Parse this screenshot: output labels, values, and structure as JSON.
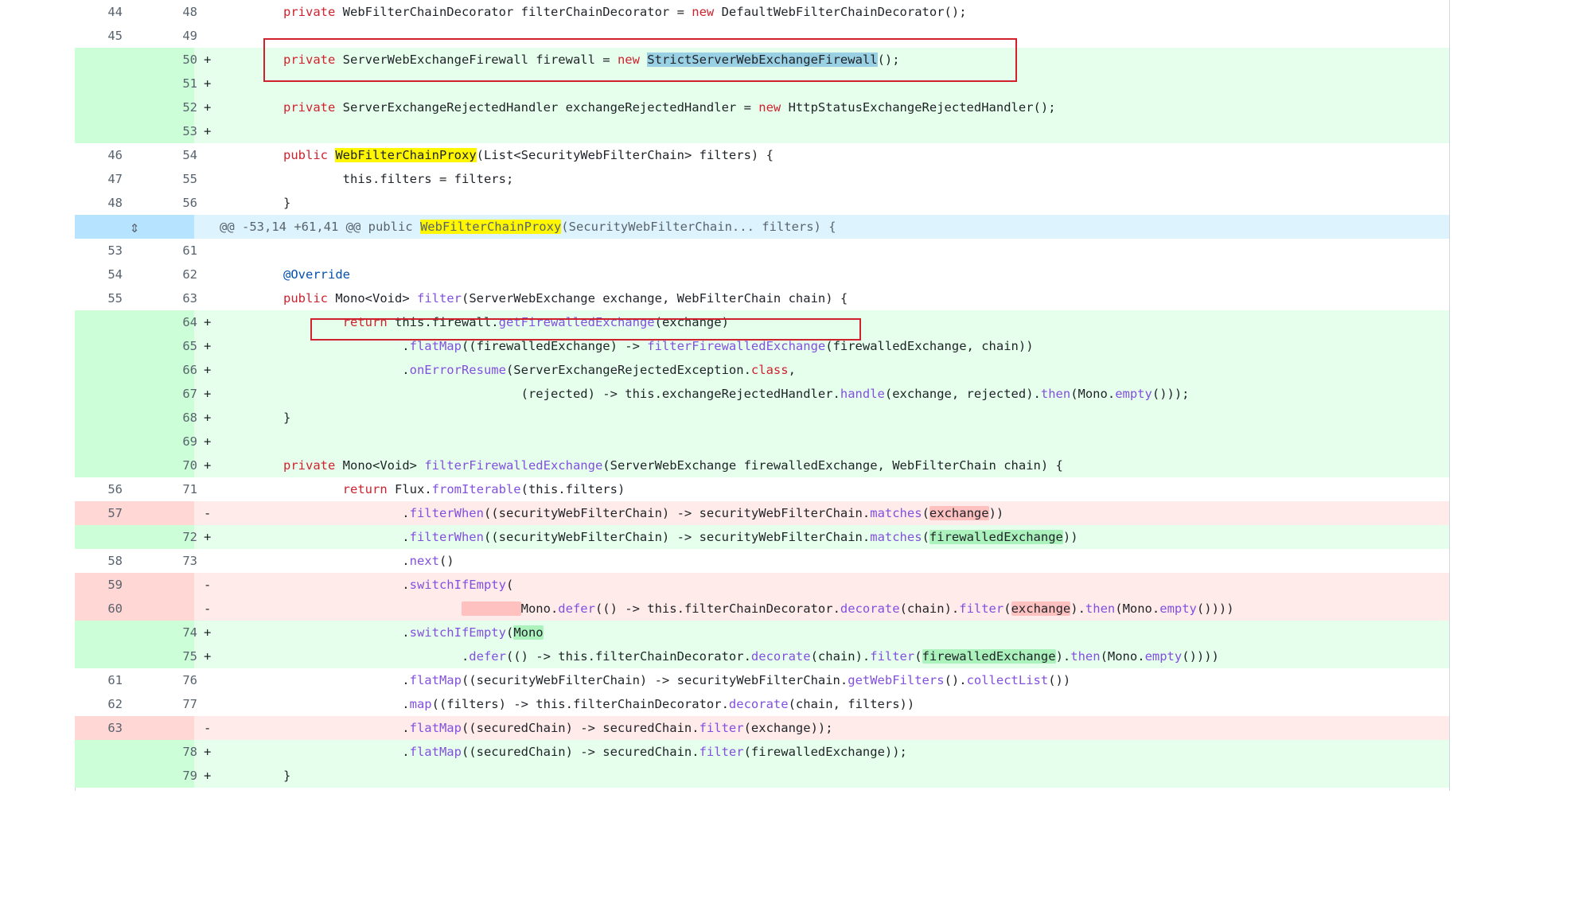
{
  "rows": [
    {
      "type": "ctx",
      "old": "44",
      "new": "48",
      "sign": "",
      "code": {
        "a": "private",
        "b": " WebFilterChainDecorator filterChainDecorator = ",
        "c": "new",
        "d": " DefaultWebFilterChainDecorator();"
      }
    },
    {
      "type": "ctx",
      "old": "45",
      "new": "49",
      "sign": "",
      "code": {
        "a": ""
      }
    },
    {
      "type": "add",
      "old": "",
      "new": "50",
      "sign": "+",
      "code": {
        "a": "private",
        "b": " ServerWebExchangeFirewall firewall = ",
        "c": "new",
        "d": " ",
        "e": "StrictServerWebExchangeFirewall",
        "f": "();"
      }
    },
    {
      "type": "add",
      "old": "",
      "new": "51",
      "sign": "+",
      "code": {
        "a": ""
      }
    },
    {
      "type": "add",
      "old": "",
      "new": "52",
      "sign": "+",
      "code": {
        "a": "private",
        "b": " ServerExchangeRejectedHandler exchangeRejectedHandler = ",
        "c": "new",
        "d": " HttpStatusExchangeRejectedHandler();"
      }
    },
    {
      "type": "add",
      "old": "",
      "new": "53",
      "sign": "+",
      "code": {
        "a": ""
      }
    },
    {
      "type": "ctx",
      "old": "46",
      "new": "54",
      "sign": "",
      "code": {
        "a": "public",
        "b": " ",
        "c": "WebFilterChainProxy",
        "d": "(List<SecurityWebFilterChain> filters) {"
      }
    },
    {
      "type": "ctx",
      "old": "47",
      "new": "55",
      "sign": "",
      "code": {
        "a": "        this.filters = filters;"
      }
    },
    {
      "type": "ctx",
      "old": "48",
      "new": "56",
      "sign": "",
      "code": {
        "a": "}"
      }
    },
    {
      "type": "hunk",
      "code": {
        "a": "@@ -53,14 +61,41 @@ public ",
        "b": "WebFilterChainProxy",
        "c": "(SecurityWebFilterChain... filters) {"
      }
    },
    {
      "type": "ctx",
      "old": "53",
      "new": "61",
      "sign": "",
      "code": {
        "a": ""
      }
    },
    {
      "type": "ctx",
      "old": "54",
      "new": "62",
      "sign": "",
      "code": {
        "a": "@Override"
      }
    },
    {
      "type": "ctx",
      "old": "55",
      "new": "63",
      "sign": "",
      "code": {
        "a": "public",
        "b": " Mono<Void> ",
        "c": "filter",
        "d": "(ServerWebExchange exchange, WebFilterChain chain) {"
      }
    },
    {
      "type": "add",
      "old": "",
      "new": "64",
      "sign": "+",
      "code": {
        "a": "        ",
        "b": "return",
        "c": " this.firewall.",
        "d": "getFirewalledExchange",
        "e": "(exchange)"
      }
    },
    {
      "type": "add",
      "old": "",
      "new": "65",
      "sign": "+",
      "code": {
        "a": "                .",
        "b": "flatMap",
        "c": "((firewalledExchange) -> ",
        "d": "filterFirewalledExchange",
        "e": "(firewalledExchange, chain))"
      }
    },
    {
      "type": "add",
      "old": "",
      "new": "66",
      "sign": "+",
      "code": {
        "a": "                .",
        "b": "onErrorResume",
        "c": "(ServerExchangeRejectedException.",
        "d": "class",
        "e": ","
      }
    },
    {
      "type": "add",
      "old": "",
      "new": "67",
      "sign": "+",
      "code": {
        "a": "                                (rejected) -> this.exchangeRejectedHandler.",
        "b": "handle",
        "c": "(exchange, rejected).",
        "d": "then",
        "e": "(Mono.",
        "f": "empty",
        "g": "()));"
      }
    },
    {
      "type": "add",
      "old": "",
      "new": "68",
      "sign": "+",
      "code": {
        "a": "}"
      }
    },
    {
      "type": "add",
      "old": "",
      "new": "69",
      "sign": "+",
      "code": {
        "a": ""
      }
    },
    {
      "type": "add",
      "old": "",
      "new": "70",
      "sign": "+",
      "code": {
        "a": "private",
        "b": " Mono<Void> ",
        "c": "filterFirewalledExchange",
        "d": "(ServerWebExchange firewalledExchange, WebFilterChain chain) {"
      }
    },
    {
      "type": "ctx",
      "old": "56",
      "new": "71",
      "sign": "",
      "code": {
        "a": "        ",
        "b": "return",
        "c": " Flux.",
        "d": "fromIterable",
        "e": "(this.filters)"
      }
    },
    {
      "type": "del",
      "old": "57",
      "new": "",
      "sign": "-",
      "code": {
        "a": "                .",
        "b": "filterWhen",
        "c": "((securityWebFilterChain) -> securityWebFilterChain.",
        "d": "matches",
        "e": "(",
        "f": "exchange",
        "g": "))"
      }
    },
    {
      "type": "add",
      "old": "",
      "new": "72",
      "sign": "+",
      "code": {
        "a": "                .",
        "b": "filterWhen",
        "c": "((securityWebFilterChain) -> securityWebFilterChain.",
        "d": "matches",
        "e": "(",
        "f": "firewalledExchange",
        "g": "))"
      }
    },
    {
      "type": "ctx",
      "old": "58",
      "new": "73",
      "sign": "",
      "code": {
        "a": "                .",
        "b": "next",
        "c": "()"
      }
    },
    {
      "type": "del",
      "old": "59",
      "new": "",
      "sign": "-",
      "code": {
        "a": "                .",
        "b": "switchIfEmpty",
        "c": "("
      }
    },
    {
      "type": "del",
      "old": "60",
      "new": "",
      "sign": "-",
      "code": {
        "a": "                        ",
        "b": "        ",
        "c": "Mono.",
        "d": "defer",
        "e": "(() -> this.filterChainDecorator.",
        "f": "decorate",
        "g": "(chain).",
        "h": "filter",
        "i": "(",
        "j": "exchange",
        "k": ").",
        "l": "then",
        "m": "(Mono.",
        "n": "empty",
        "o": "())))"
      }
    },
    {
      "type": "add",
      "old": "",
      "new": "74",
      "sign": "+",
      "code": {
        "a": "                .",
        "b": "switchIfEmpty",
        "c": "(",
        "d": "Mono"
      }
    },
    {
      "type": "add",
      "old": "",
      "new": "75",
      "sign": "+",
      "code": {
        "a": "                        .",
        "b": "defer",
        "c": "(() -> this.filterChainDecorator.",
        "d": "decorate",
        "e": "(chain).",
        "f": "filter",
        "g": "(",
        "h": "firewalledExchange",
        "i": ").",
        "j": "then",
        "k": "(Mono.",
        "l": "empty",
        "m": "())))"
      }
    },
    {
      "type": "ctx",
      "old": "61",
      "new": "76",
      "sign": "",
      "code": {
        "a": "                .",
        "b": "flatMap",
        "c": "((securityWebFilterChain) -> securityWebFilterChain.",
        "d": "getWebFilters",
        "e": "().",
        "f": "collectList",
        "g": "())"
      }
    },
    {
      "type": "ctx",
      "old": "62",
      "new": "77",
      "sign": "",
      "code": {
        "a": "                .",
        "b": "map",
        "c": "((filters) -> this.filterChainDecorator.",
        "d": "decorate",
        "e": "(chain, filters))"
      }
    },
    {
      "type": "del",
      "old": "63",
      "new": "",
      "sign": "-",
      "code": {
        "a": "                .",
        "b": "flatMap",
        "c": "((securedChain) -> securedChain.",
        "d": "filter",
        "e": "(exchange));"
      }
    },
    {
      "type": "add",
      "old": "",
      "new": "78",
      "sign": "+",
      "code": {
        "a": "                .",
        "b": "flatMap",
        "c": "((securedChain) -> securedChain.",
        "d": "filter",
        "e": "(firewalledExchange));"
      }
    },
    {
      "type": "add",
      "old": "",
      "new": "79",
      "sign": "+",
      "code": {
        "a": "}"
      }
    }
  ]
}
